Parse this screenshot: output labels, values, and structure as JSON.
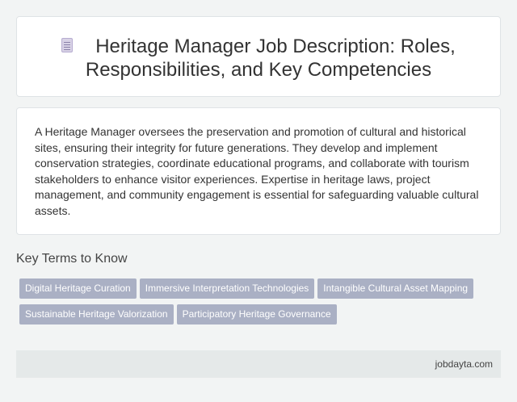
{
  "header": {
    "icon": "document-icon",
    "title": "Heritage Manager Job Description: Roles, Responsibilities, and Key Competencies"
  },
  "description": "A Heritage Manager oversees the preservation and promotion of cultural and historical sites, ensuring their integrity for future generations. They develop and implement conservation strategies, coordinate educational programs, and collaborate with tourism stakeholders to enhance visitor experiences. Expertise in heritage laws, project management, and community engagement is essential for safeguarding valuable cultural assets.",
  "key_terms": {
    "heading": "Key Terms to Know",
    "tags": [
      "Digital Heritage Curation",
      "Immersive Interpretation Technologies",
      "Intangible Cultural Asset Mapping",
      "Sustainable Heritage Valorization",
      "Participatory Heritage Governance"
    ]
  },
  "footer": {
    "site": "jobdayta.com"
  },
  "colors": {
    "background": "#f2f4f4",
    "tag": "#aab0c4",
    "footer": "#e5e9e9"
  }
}
